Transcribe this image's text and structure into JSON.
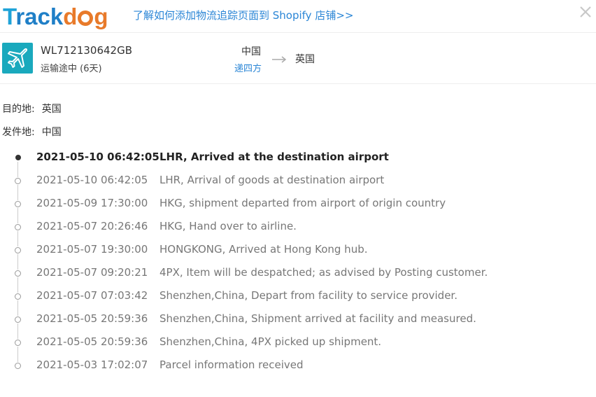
{
  "header": {
    "logo_text": "Trackdog",
    "promo_link": "了解如何添加物流追踪页面到 Shopify 店铺>>",
    "close_icon": "close-icon"
  },
  "shipment": {
    "carrier_icon": "airplane-icon",
    "carrier_icon_color": "#1aa9bd",
    "tracking_number": "WL712130642GB",
    "status": "运输途中 (6天)",
    "origin": "中国",
    "carrier": "递四方",
    "destination": "英国"
  },
  "info": {
    "destination_label": "目的地:",
    "destination_value": "英国",
    "origin_label": "发件地:",
    "origin_value": "中国"
  },
  "events": [
    {
      "time": "2021-05-10 06:42:05",
      "desc": "LHR, Arrived at the destination airport"
    },
    {
      "time": "2021-05-10 06:42:05",
      "desc": "LHR, Arrival of goods at destination airport"
    },
    {
      "time": "2021-05-09 17:30:00",
      "desc": "HKG, shipment departed from airport of origin country"
    },
    {
      "time": "2021-05-07 20:26:46",
      "desc": "HKG, Hand over to airline."
    },
    {
      "time": "2021-05-07 19:30:00",
      "desc": "HONGKONG, Arrived at Hong Kong hub."
    },
    {
      "time": "2021-05-07 09:20:21",
      "desc": "4PX, Item will be despatched; as advised by Posting customer."
    },
    {
      "time": "2021-05-07 07:03:42",
      "desc": "Shenzhen,China, Depart from facility to service provider."
    },
    {
      "time": "2021-05-05 20:59:36",
      "desc": "Shenzhen,China, Shipment arrived at facility and measured."
    },
    {
      "time": "2021-05-05 20:59:36",
      "desc": "Shenzhen,China, 4PX picked up shipment."
    },
    {
      "time": "2021-05-03 17:02:07",
      "desc": "Parcel information received"
    }
  ]
}
